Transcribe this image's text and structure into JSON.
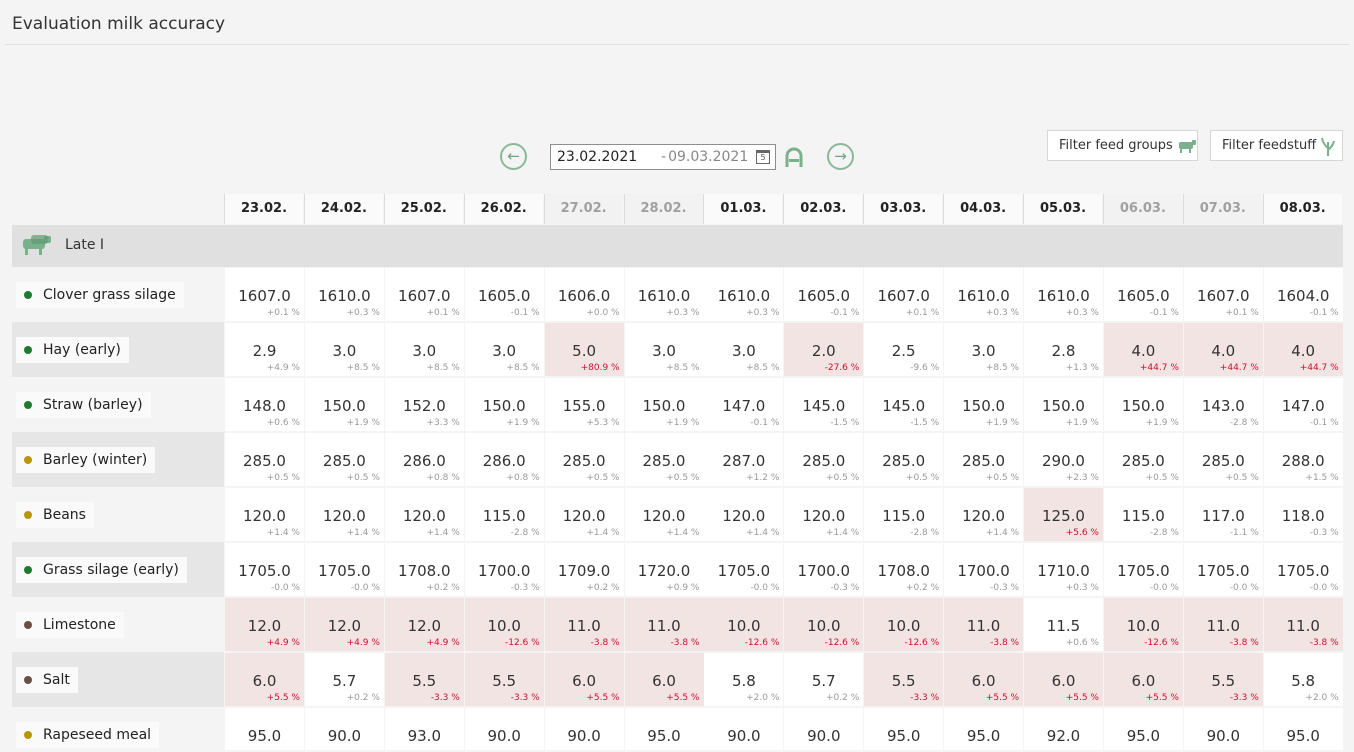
{
  "page": {
    "title": "Evaluation milk accuracy"
  },
  "date_range": {
    "from": "23.02.2021",
    "separator": "-",
    "to": "09.03.2021",
    "calendar_glyph": "5"
  },
  "filters": {
    "feed_groups_label": "Filter feed groups",
    "feedstuff_label": "Filter feedstuff"
  },
  "group": {
    "name": "Late I"
  },
  "columns": [
    {
      "label": "23.02.",
      "weekend": false
    },
    {
      "label": "24.02.",
      "weekend": false
    },
    {
      "label": "25.02.",
      "weekend": false
    },
    {
      "label": "26.02.",
      "weekend": false
    },
    {
      "label": "27.02.",
      "weekend": true
    },
    {
      "label": "28.02.",
      "weekend": true
    },
    {
      "label": "01.03.",
      "weekend": false
    },
    {
      "label": "02.03.",
      "weekend": false
    },
    {
      "label": "03.03.",
      "weekend": false
    },
    {
      "label": "04.03.",
      "weekend": false
    },
    {
      "label": "05.03.",
      "weekend": false
    },
    {
      "label": "06.03.",
      "weekend": true
    },
    {
      "label": "07.03.",
      "weekend": true
    },
    {
      "label": "08.03.",
      "weekend": false
    }
  ],
  "colors": {
    "green": "#1e7a2e",
    "gold": "#b8960a",
    "brown": "#6b4f43",
    "highlight": "#f3e4e4",
    "deviation_red": "#c8102e",
    "icon_green": "#7bb08c"
  },
  "rows": [
    {
      "name": "Clover grass silage",
      "dot": "green",
      "cells": [
        {
          "v": "1607.0",
          "p": "+0.1 %"
        },
        {
          "v": "1610.0",
          "p": "+0.3 %"
        },
        {
          "v": "1607.0",
          "p": "+0.1 %"
        },
        {
          "v": "1605.0",
          "p": "-0.1 %"
        },
        {
          "v": "1606.0",
          "p": "+0.0 %"
        },
        {
          "v": "1610.0",
          "p": "+0.3 %"
        },
        {
          "v": "1610.0",
          "p": "+0.3 %"
        },
        {
          "v": "1605.0",
          "p": "-0.1 %"
        },
        {
          "v": "1607.0",
          "p": "+0.1 %"
        },
        {
          "v": "1610.0",
          "p": "+0.3 %"
        },
        {
          "v": "1610.0",
          "p": "+0.3 %"
        },
        {
          "v": "1605.0",
          "p": "-0.1 %"
        },
        {
          "v": "1607.0",
          "p": "+0.1 %"
        },
        {
          "v": "1604.0",
          "p": "-0.1 %"
        }
      ]
    },
    {
      "name": "Hay (early)",
      "dot": "green",
      "cells": [
        {
          "v": "2.9",
          "p": "+4.9 %"
        },
        {
          "v": "3.0",
          "p": "+8.5 %"
        },
        {
          "v": "3.0",
          "p": "+8.5 %"
        },
        {
          "v": "3.0",
          "p": "+8.5 %"
        },
        {
          "v": "5.0",
          "p": "+80.9 %",
          "hl": true
        },
        {
          "v": "3.0",
          "p": "+8.5 %"
        },
        {
          "v": "3.0",
          "p": "+8.5 %"
        },
        {
          "v": "2.0",
          "p": "-27.6 %",
          "hl": true
        },
        {
          "v": "2.5",
          "p": "-9.6 %"
        },
        {
          "v": "3.0",
          "p": "+8.5 %"
        },
        {
          "v": "2.8",
          "p": "+1.3 %"
        },
        {
          "v": "4.0",
          "p": "+44.7 %",
          "hl": true
        },
        {
          "v": "4.0",
          "p": "+44.7 %",
          "hl": true
        },
        {
          "v": "4.0",
          "p": "+44.7 %",
          "hl": true
        }
      ]
    },
    {
      "name": "Straw (barley)",
      "dot": "green",
      "cells": [
        {
          "v": "148.0",
          "p": "+0.6 %"
        },
        {
          "v": "150.0",
          "p": "+1.9 %"
        },
        {
          "v": "152.0",
          "p": "+3.3 %"
        },
        {
          "v": "150.0",
          "p": "+1.9 %"
        },
        {
          "v": "155.0",
          "p": "+5.3 %"
        },
        {
          "v": "150.0",
          "p": "+1.9 %"
        },
        {
          "v": "147.0",
          "p": "-0.1 %"
        },
        {
          "v": "145.0",
          "p": "-1.5 %"
        },
        {
          "v": "145.0",
          "p": "-1.5 %"
        },
        {
          "v": "150.0",
          "p": "+1.9 %"
        },
        {
          "v": "150.0",
          "p": "+1.9 %"
        },
        {
          "v": "150.0",
          "p": "+1.9 %"
        },
        {
          "v": "143.0",
          "p": "-2.8 %"
        },
        {
          "v": "147.0",
          "p": "-0.1 %"
        }
      ]
    },
    {
      "name": "Barley (winter)",
      "dot": "gold",
      "cells": [
        {
          "v": "285.0",
          "p": "+0.5 %"
        },
        {
          "v": "285.0",
          "p": "+0.5 %"
        },
        {
          "v": "286.0",
          "p": "+0.8 %"
        },
        {
          "v": "286.0",
          "p": "+0.8 %"
        },
        {
          "v": "285.0",
          "p": "+0.5 %"
        },
        {
          "v": "285.0",
          "p": "+0.5 %"
        },
        {
          "v": "287.0",
          "p": "+1.2 %"
        },
        {
          "v": "285.0",
          "p": "+0.5 %"
        },
        {
          "v": "285.0",
          "p": "+0.5 %"
        },
        {
          "v": "285.0",
          "p": "+0.5 %"
        },
        {
          "v": "290.0",
          "p": "+2.3 %"
        },
        {
          "v": "285.0",
          "p": "+0.5 %"
        },
        {
          "v": "285.0",
          "p": "+0.5 %"
        },
        {
          "v": "288.0",
          "p": "+1.5 %"
        }
      ]
    },
    {
      "name": "Beans",
      "dot": "gold",
      "cells": [
        {
          "v": "120.0",
          "p": "+1.4 %"
        },
        {
          "v": "120.0",
          "p": "+1.4 %"
        },
        {
          "v": "120.0",
          "p": "+1.4 %"
        },
        {
          "v": "115.0",
          "p": "-2.8 %"
        },
        {
          "v": "120.0",
          "p": "+1.4 %"
        },
        {
          "v": "120.0",
          "p": "+1.4 %"
        },
        {
          "v": "120.0",
          "p": "+1.4 %"
        },
        {
          "v": "120.0",
          "p": "+1.4 %"
        },
        {
          "v": "115.0",
          "p": "-2.8 %"
        },
        {
          "v": "120.0",
          "p": "+1.4 %"
        },
        {
          "v": "125.0",
          "p": "+5.6 %",
          "hl": true
        },
        {
          "v": "115.0",
          "p": "-2.8 %"
        },
        {
          "v": "117.0",
          "p": "-1.1 %"
        },
        {
          "v": "118.0",
          "p": "-0.3 %"
        }
      ]
    },
    {
      "name": "Grass silage (early)",
      "dot": "green",
      "cells": [
        {
          "v": "1705.0",
          "p": "-0.0 %"
        },
        {
          "v": "1705.0",
          "p": "-0.0 %"
        },
        {
          "v": "1708.0",
          "p": "+0.2 %"
        },
        {
          "v": "1700.0",
          "p": "-0.3 %"
        },
        {
          "v": "1709.0",
          "p": "+0.2 %"
        },
        {
          "v": "1720.0",
          "p": "+0.9 %"
        },
        {
          "v": "1705.0",
          "p": "-0.0 %"
        },
        {
          "v": "1700.0",
          "p": "-0.3 %"
        },
        {
          "v": "1708.0",
          "p": "+0.2 %"
        },
        {
          "v": "1700.0",
          "p": "-0.3 %"
        },
        {
          "v": "1710.0",
          "p": "+0.3 %"
        },
        {
          "v": "1705.0",
          "p": "-0.0 %"
        },
        {
          "v": "1705.0",
          "p": "-0.0 %"
        },
        {
          "v": "1705.0",
          "p": "-0.0 %"
        }
      ]
    },
    {
      "name": "Limestone",
      "dot": "brown",
      "cells": [
        {
          "v": "12.0",
          "p": "+4.9 %",
          "hl": true
        },
        {
          "v": "12.0",
          "p": "+4.9 %",
          "hl": true
        },
        {
          "v": "12.0",
          "p": "+4.9 %",
          "hl": true
        },
        {
          "v": "10.0",
          "p": "-12.6 %",
          "hl": true
        },
        {
          "v": "11.0",
          "p": "-3.8 %",
          "hl": true
        },
        {
          "v": "11.0",
          "p": "-3.8 %",
          "hl": true
        },
        {
          "v": "10.0",
          "p": "-12.6 %",
          "hl": true
        },
        {
          "v": "10.0",
          "p": "-12.6 %",
          "hl": true
        },
        {
          "v": "10.0",
          "p": "-12.6 %",
          "hl": true
        },
        {
          "v": "11.0",
          "p": "-3.8 %",
          "hl": true
        },
        {
          "v": "11.5",
          "p": "+0.6 %"
        },
        {
          "v": "10.0",
          "p": "-12.6 %",
          "hl": true
        },
        {
          "v": "11.0",
          "p": "-3.8 %",
          "hl": true
        },
        {
          "v": "11.0",
          "p": "-3.8 %",
          "hl": true
        }
      ]
    },
    {
      "name": "Salt",
      "dot": "brown",
      "cells": [
        {
          "v": "6.0",
          "p": "+5.5 %",
          "hl": true
        },
        {
          "v": "5.7",
          "p": "+0.2 %"
        },
        {
          "v": "5.5",
          "p": "-3.3 %",
          "hl": true
        },
        {
          "v": "5.5",
          "p": "-3.3 %",
          "hl": true
        },
        {
          "v": "6.0",
          "p": "+5.5 %",
          "hl": true
        },
        {
          "v": "6.0",
          "p": "+5.5 %",
          "hl": true
        },
        {
          "v": "5.8",
          "p": "+2.0 %"
        },
        {
          "v": "5.7",
          "p": "+0.2 %"
        },
        {
          "v": "5.5",
          "p": "-3.3 %",
          "hl": true
        },
        {
          "v": "6.0",
          "p": "+5.5 %",
          "hl": true
        },
        {
          "v": "6.0",
          "p": "+5.5 %",
          "hl": true
        },
        {
          "v": "6.0",
          "p": "+5.5 %",
          "hl": true
        },
        {
          "v": "5.5",
          "p": "-3.3 %",
          "hl": true
        },
        {
          "v": "5.8",
          "p": "+2.0 %"
        }
      ]
    },
    {
      "name": "Rapeseed meal",
      "dot": "gold",
      "cells": [
        {
          "v": "95.0",
          "p": ""
        },
        {
          "v": "90.0",
          "p": ""
        },
        {
          "v": "93.0",
          "p": ""
        },
        {
          "v": "90.0",
          "p": ""
        },
        {
          "v": "90.0",
          "p": ""
        },
        {
          "v": "95.0",
          "p": ""
        },
        {
          "v": "90.0",
          "p": ""
        },
        {
          "v": "90.0",
          "p": ""
        },
        {
          "v": "95.0",
          "p": ""
        },
        {
          "v": "95.0",
          "p": ""
        },
        {
          "v": "92.0",
          "p": ""
        },
        {
          "v": "95.0",
          "p": ""
        },
        {
          "v": "90.0",
          "p": ""
        },
        {
          "v": "95.0",
          "p": ""
        }
      ]
    }
  ]
}
